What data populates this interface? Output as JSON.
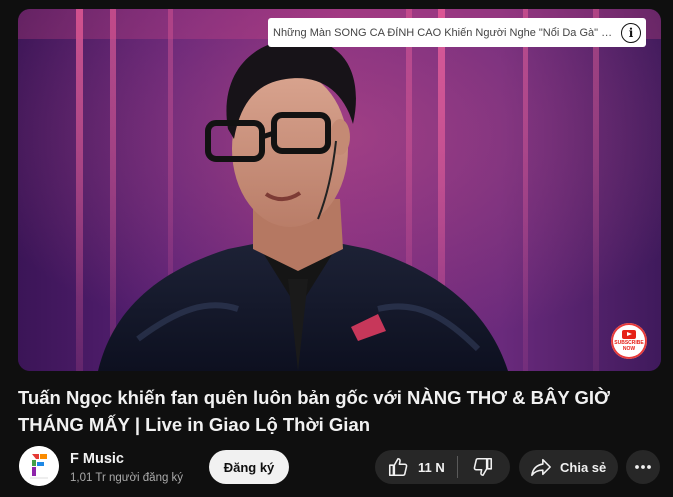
{
  "video": {
    "info_card_text": "Những Màn SONG CA ĐỈNH CAO Khiến Người Nghe \"Nổi Da Gà\" tại ...",
    "info_icon": "info-icon",
    "subscribe_badge_text": "SUBSCRIBE NOW"
  },
  "title": "Tuấn Ngọc khiến fan quên luôn bản gốc với NÀNG THƠ & BÂY GIỜ THÁNG MẤY | Live in Giao Lộ Thời Gian",
  "channel": {
    "name": "F Music",
    "subscribers": "1,01 Tr người đăng ký",
    "avatar_letter": "F",
    "avatar_caption": "MUSIC",
    "subscribe_label": "Đăng ký"
  },
  "actions": {
    "like_count": "11 N",
    "share_label": "Chia sẻ",
    "icons": [
      "like-icon",
      "dislike-icon",
      "share-icon",
      "more-icon"
    ]
  },
  "colors": {
    "background": "#0f0f0f",
    "pill": "#272727",
    "subscribe_button": "#f1f1f1",
    "secondary_text": "#aaaaaa"
  }
}
